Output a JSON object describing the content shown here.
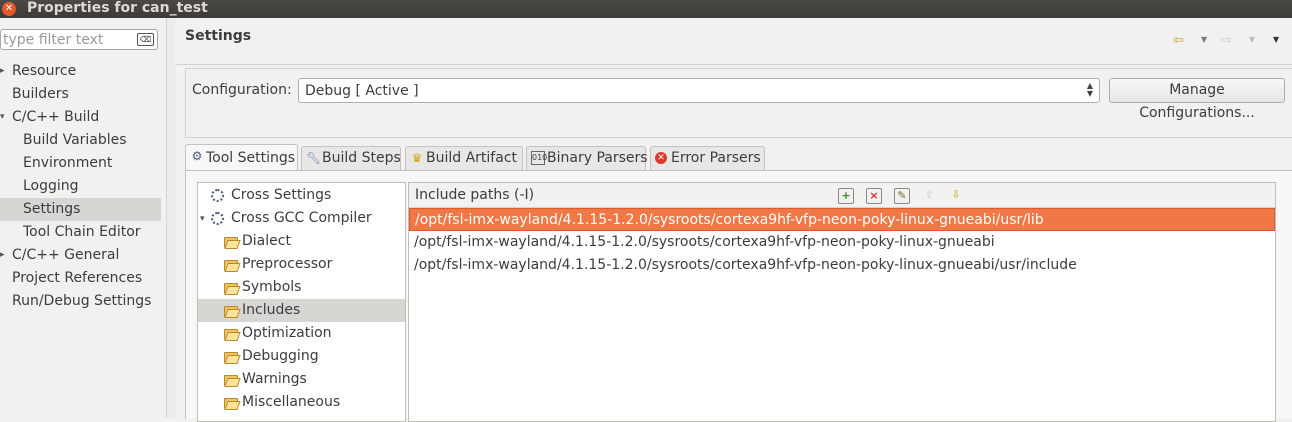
{
  "window": {
    "title": "Properties for can_test"
  },
  "left": {
    "filter_placeholder": "type filter text",
    "items": [
      {
        "label": "Resource",
        "arrow": "▸"
      },
      {
        "label": "Builders",
        "arrow": ""
      },
      {
        "label": "C/C++ Build",
        "arrow": "▾"
      },
      {
        "label": "Build Variables",
        "arrow": ""
      },
      {
        "label": "Environment",
        "arrow": ""
      },
      {
        "label": "Logging",
        "arrow": ""
      },
      {
        "label": "Settings",
        "arrow": ""
      },
      {
        "label": "Tool Chain Editor",
        "arrow": ""
      },
      {
        "label": "C/C++ General",
        "arrow": "▸"
      },
      {
        "label": "Project References",
        "arrow": ""
      },
      {
        "label": "Run/Debug Settings",
        "arrow": ""
      }
    ]
  },
  "header": {
    "title": "Settings"
  },
  "config": {
    "label": "Configuration:",
    "value": "Debug  [ Active ]",
    "manage_label": "Manage Configurations..."
  },
  "tabs": [
    {
      "label": "Tool Settings",
      "icon": "gear-icon"
    },
    {
      "label": "Build Steps",
      "icon": "wrench-icon"
    },
    {
      "label": "Build Artifact",
      "icon": "trophy-icon"
    },
    {
      "label": "Binary Parsers",
      "icon": "binary-icon"
    },
    {
      "label": "Error Parsers",
      "icon": "error-icon"
    }
  ],
  "tool_tree": [
    {
      "label": "Cross Settings",
      "arrow": ""
    },
    {
      "label": "Cross GCC Compiler",
      "arrow": "▾"
    },
    {
      "label": "Dialect",
      "arrow": ""
    },
    {
      "label": "Preprocessor",
      "arrow": ""
    },
    {
      "label": "Symbols",
      "arrow": ""
    },
    {
      "label": "Includes",
      "arrow": ""
    },
    {
      "label": "Optimization",
      "arrow": ""
    },
    {
      "label": "Debugging",
      "arrow": ""
    },
    {
      "label": "Warnings",
      "arrow": ""
    },
    {
      "label": "Miscellaneous",
      "arrow": ""
    }
  ],
  "includes": {
    "header": "Include paths (-I)",
    "paths": [
      "/opt/fsl-imx-wayland/4.1.15-1.2.0/sysroots/cortexa9hf-vfp-neon-poky-linux-gnueabi/usr/lib",
      "/opt/fsl-imx-wayland/4.1.15-1.2.0/sysroots/cortexa9hf-vfp-neon-poky-linux-gnueabi",
      "/opt/fsl-imx-wayland/4.1.15-1.2.0/sysroots/cortexa9hf-vfp-neon-poky-linux-gnueabi/usr/include"
    ]
  },
  "colors": {
    "selection": "#f07746",
    "titlebar": "#3c3b37"
  }
}
